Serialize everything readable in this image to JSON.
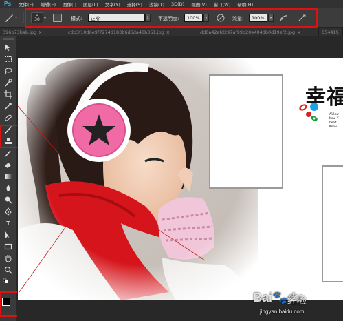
{
  "app": {
    "logo_text": "Ps",
    "menu": [
      "文件(F)",
      "编辑(E)",
      "图像(I)",
      "图层(L)",
      "文字(Y)",
      "选择(S)",
      "滤镜(T)",
      "3D(D)",
      "视图(V)",
      "窗口(W)",
      "帮助(H)"
    ]
  },
  "options": {
    "brush_size": "30",
    "mode_label": "模式:",
    "mode_value": "正常",
    "opacity_label": "不透明度:",
    "opacity_value": "100%",
    "flow_label": "流量:",
    "flow_value": "100%"
  },
  "tabs": [
    "396b73bab.jpg",
    "cdb3f10d6e9f7274d183b6d6da48b351.jpg",
    "dd0a42afd297af99d20e404db0d19ef2.jpg",
    "654419"
  ],
  "tab_close": "×",
  "canvas": {
    "title": "幸福",
    "small_text": "Allow\nNew Y\nbeat\nKnow"
  },
  "watermark": {
    "brand": "Bai",
    "brand_suffix": "du",
    "word": "经验",
    "url": "jingyan.baidu.com"
  },
  "colors": {
    "highlight": "#e01010",
    "panel": "#3c3c3c",
    "menubar": "#323232"
  }
}
